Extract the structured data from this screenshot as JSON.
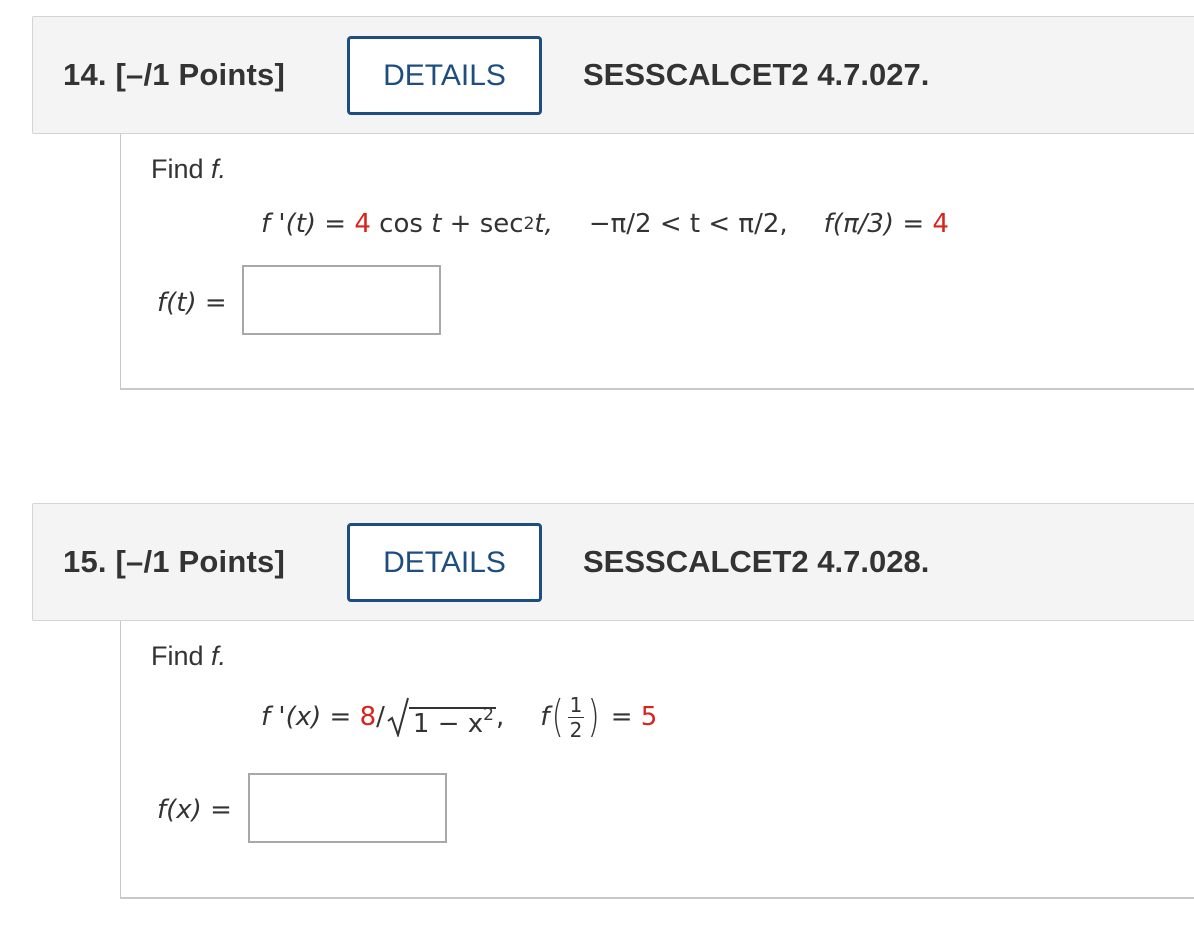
{
  "questions": [
    {
      "number_label": "14.  [–/1 Points]",
      "details_label": "DETAILS",
      "reference": "SESSCALCET2 4.7.027.",
      "prompt_text": "Find ",
      "prompt_var": "f.",
      "equation": {
        "lhs": "f '(t)",
        "eq": " = ",
        "coef": "4",
        "term1": " cos ",
        "t1": "t",
        "plus": " + sec",
        "exp": "2",
        "t2": "t,",
        "domain": "−π/2 < t < π/2,",
        "cond_lhs": "f(π/3)",
        "cond_eq": " = ",
        "cond_val": "4"
      },
      "answer_label": "f(t)",
      "answer_eq": " =",
      "answer_value": ""
    },
    {
      "number_label": "15.  [–/1 Points]",
      "details_label": "DETAILS",
      "reference": "SESSCALCET2 4.7.028.",
      "prompt_text": "Find ",
      "prompt_var": "f.",
      "equation": {
        "lhs": "f '(x)",
        "eq": " = ",
        "coef": "8",
        "slash": "/",
        "rad_text": "1 − x",
        "rad_exp": "2",
        "comma": ",",
        "cond_f": "f",
        "frac_num": "1",
        "frac_den": "2",
        "cond_eq": " = ",
        "cond_val": "5"
      },
      "answer_label": "f(x)",
      "answer_eq": " =",
      "answer_value": ""
    }
  ],
  "colors": {
    "accent": "#1e4e80",
    "highlight": "#d9231d",
    "header_bg": "#f4f4f4"
  }
}
